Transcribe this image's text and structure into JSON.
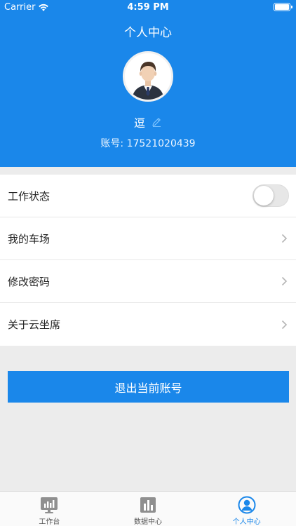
{
  "status_bar": {
    "carrier": "Carrier",
    "time": "4:59 PM"
  },
  "header": {
    "title": "个人中心",
    "username": "逗",
    "account": "账号: 17521020439"
  },
  "menu": {
    "items": [
      {
        "label": "工作状态",
        "type": "toggle",
        "checked": false
      },
      {
        "label": "我的车场",
        "type": "link"
      },
      {
        "label": "修改密码",
        "type": "link"
      },
      {
        "label": "关于云坐席",
        "type": "link"
      }
    ]
  },
  "logout": {
    "label": "退出当前账号"
  },
  "tabbar": {
    "tabs": [
      {
        "label": "工作台",
        "icon": "workbench-icon"
      },
      {
        "label": "数据中心",
        "icon": "bar-chart-icon"
      },
      {
        "label": "个人中心",
        "icon": "person-icon"
      }
    ],
    "active_index": 2
  },
  "colors": {
    "brand": "#1a87ea",
    "background": "#ececec"
  }
}
